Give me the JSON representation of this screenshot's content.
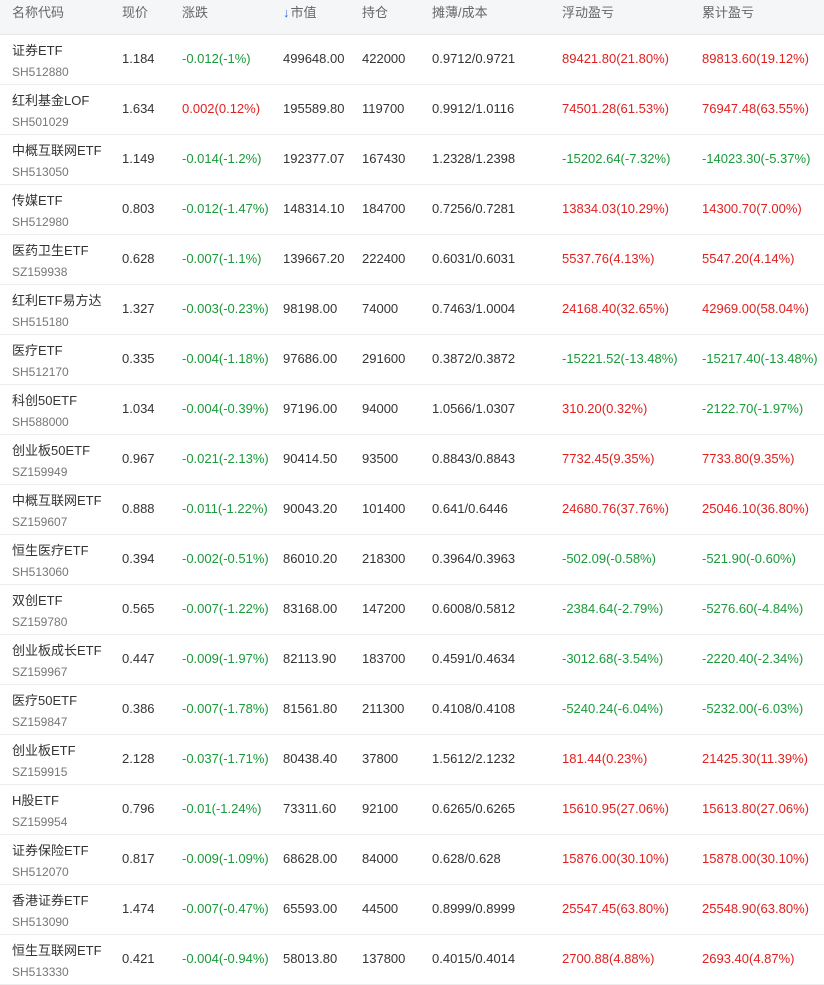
{
  "colors": {
    "up": "#e02020",
    "down": "#1a9a3a",
    "sort_accent": "#2f6fd6"
  },
  "headers": {
    "name_code": "名称代码",
    "price": "现价",
    "change": "涨跌",
    "sort_icon": "↓",
    "market_value": "市值",
    "position": "持仓",
    "cost": "摊薄/成本",
    "floating_pl": "浮动盈亏",
    "cumulative_pl": "累计盈亏"
  },
  "rows": [
    {
      "name": "证券ETF",
      "code": "SH512880",
      "price": "1.184",
      "change": "-0.012(-1%)",
      "change_dir": "down",
      "market_value": "499648.00",
      "position": "422000",
      "cost": "0.9712/0.9721",
      "floating_pl": "89421.80(21.80%)",
      "floating_dir": "up",
      "cumulative_pl": "89813.60(19.12%)",
      "cumulative_dir": "up"
    },
    {
      "name": "红利基金LOF",
      "code": "SH501029",
      "price": "1.634",
      "change": "0.002(0.12%)",
      "change_dir": "up",
      "market_value": "195589.80",
      "position": "119700",
      "cost": "0.9912/1.0116",
      "floating_pl": "74501.28(61.53%)",
      "floating_dir": "up",
      "cumulative_pl": "76947.48(63.55%)",
      "cumulative_dir": "up"
    },
    {
      "name": "中概互联网ETF",
      "code": "SH513050",
      "price": "1.149",
      "change": "-0.014(-1.2%)",
      "change_dir": "down",
      "market_value": "192377.07",
      "position": "167430",
      "cost": "1.2328/1.2398",
      "floating_pl": "-15202.64(-7.32%)",
      "floating_dir": "down",
      "cumulative_pl": "-14023.30(-5.37%)",
      "cumulative_dir": "down"
    },
    {
      "name": "传媒ETF",
      "code": "SH512980",
      "price": "0.803",
      "change": "-0.012(-1.47%)",
      "change_dir": "down",
      "market_value": "148314.10",
      "position": "184700",
      "cost": "0.7256/0.7281",
      "floating_pl": "13834.03(10.29%)",
      "floating_dir": "up",
      "cumulative_pl": "14300.70(7.00%)",
      "cumulative_dir": "up"
    },
    {
      "name": "医药卫生ETF",
      "code": "SZ159938",
      "price": "0.628",
      "change": "-0.007(-1.1%)",
      "change_dir": "down",
      "market_value": "139667.20",
      "position": "222400",
      "cost": "0.6031/0.6031",
      "floating_pl": "5537.76(4.13%)",
      "floating_dir": "up",
      "cumulative_pl": "5547.20(4.14%)",
      "cumulative_dir": "up"
    },
    {
      "name": "红利ETF易方达",
      "code": "SH515180",
      "price": "1.327",
      "change": "-0.003(-0.23%)",
      "change_dir": "down",
      "market_value": "98198.00",
      "position": "74000",
      "cost": "0.7463/1.0004",
      "floating_pl": "24168.40(32.65%)",
      "floating_dir": "up",
      "cumulative_pl": "42969.00(58.04%)",
      "cumulative_dir": "up"
    },
    {
      "name": "医疗ETF",
      "code": "SH512170",
      "price": "0.335",
      "change": "-0.004(-1.18%)",
      "change_dir": "down",
      "market_value": "97686.00",
      "position": "291600",
      "cost": "0.3872/0.3872",
      "floating_pl": "-15221.52(-13.48%)",
      "floating_dir": "down",
      "cumulative_pl": "-15217.40(-13.48%)",
      "cumulative_dir": "down"
    },
    {
      "name": "科创50ETF",
      "code": "SH588000",
      "price": "1.034",
      "change": "-0.004(-0.39%)",
      "change_dir": "down",
      "market_value": "97196.00",
      "position": "94000",
      "cost": "1.0566/1.0307",
      "floating_pl": "310.20(0.32%)",
      "floating_dir": "up",
      "cumulative_pl": "-2122.70(-1.97%)",
      "cumulative_dir": "down"
    },
    {
      "name": "创业板50ETF",
      "code": "SZ159949",
      "price": "0.967",
      "change": "-0.021(-2.13%)",
      "change_dir": "down",
      "market_value": "90414.50",
      "position": "93500",
      "cost": "0.8843/0.8843",
      "floating_pl": "7732.45(9.35%)",
      "floating_dir": "up",
      "cumulative_pl": "7733.80(9.35%)",
      "cumulative_dir": "up"
    },
    {
      "name": "中概互联网ETF",
      "code": "SZ159607",
      "price": "0.888",
      "change": "-0.011(-1.22%)",
      "change_dir": "down",
      "market_value": "90043.20",
      "position": "101400",
      "cost": "0.641/0.6446",
      "floating_pl": "24680.76(37.76%)",
      "floating_dir": "up",
      "cumulative_pl": "25046.10(36.80%)",
      "cumulative_dir": "up"
    },
    {
      "name": "恒生医疗ETF",
      "code": "SH513060",
      "price": "0.394",
      "change": "-0.002(-0.51%)",
      "change_dir": "down",
      "market_value": "86010.20",
      "position": "218300",
      "cost": "0.3964/0.3963",
      "floating_pl": "-502.09(-0.58%)",
      "floating_dir": "down",
      "cumulative_pl": "-521.90(-0.60%)",
      "cumulative_dir": "down"
    },
    {
      "name": "双创ETF",
      "code": "SZ159780",
      "price": "0.565",
      "change": "-0.007(-1.22%)",
      "change_dir": "down",
      "market_value": "83168.00",
      "position": "147200",
      "cost": "0.6008/0.5812",
      "floating_pl": "-2384.64(-2.79%)",
      "floating_dir": "down",
      "cumulative_pl": "-5276.60(-4.84%)",
      "cumulative_dir": "down"
    },
    {
      "name": "创业板成长ETF",
      "code": "SZ159967",
      "price": "0.447",
      "change": "-0.009(-1.97%)",
      "change_dir": "down",
      "market_value": "82113.90",
      "position": "183700",
      "cost": "0.4591/0.4634",
      "floating_pl": "-3012.68(-3.54%)",
      "floating_dir": "down",
      "cumulative_pl": "-2220.40(-2.34%)",
      "cumulative_dir": "down"
    },
    {
      "name": "医疗50ETF",
      "code": "SZ159847",
      "price": "0.386",
      "change": "-0.007(-1.78%)",
      "change_dir": "down",
      "market_value": "81561.80",
      "position": "211300",
      "cost": "0.4108/0.4108",
      "floating_pl": "-5240.24(-6.04%)",
      "floating_dir": "down",
      "cumulative_pl": "-5232.00(-6.03%)",
      "cumulative_dir": "down"
    },
    {
      "name": "创业板ETF",
      "code": "SZ159915",
      "price": "2.128",
      "change": "-0.037(-1.71%)",
      "change_dir": "down",
      "market_value": "80438.40",
      "position": "37800",
      "cost": "1.5612/2.1232",
      "floating_pl": "181.44(0.23%)",
      "floating_dir": "up",
      "cumulative_pl": "21425.30(11.39%)",
      "cumulative_dir": "up"
    },
    {
      "name": "H股ETF",
      "code": "SZ159954",
      "price": "0.796",
      "change": "-0.01(-1.24%)",
      "change_dir": "down",
      "market_value": "73311.60",
      "position": "92100",
      "cost": "0.6265/0.6265",
      "floating_pl": "15610.95(27.06%)",
      "floating_dir": "up",
      "cumulative_pl": "15613.80(27.06%)",
      "cumulative_dir": "up"
    },
    {
      "name": "证券保险ETF",
      "code": "SH512070",
      "price": "0.817",
      "change": "-0.009(-1.09%)",
      "change_dir": "down",
      "market_value": "68628.00",
      "position": "84000",
      "cost": "0.628/0.628",
      "floating_pl": "15876.00(30.10%)",
      "floating_dir": "up",
      "cumulative_pl": "15878.00(30.10%)",
      "cumulative_dir": "up"
    },
    {
      "name": "香港证券ETF",
      "code": "SH513090",
      "price": "1.474",
      "change": "-0.007(-0.47%)",
      "change_dir": "down",
      "market_value": "65593.00",
      "position": "44500",
      "cost": "0.8999/0.8999",
      "floating_pl": "25547.45(63.80%)",
      "floating_dir": "up",
      "cumulative_pl": "25548.90(63.80%)",
      "cumulative_dir": "up"
    },
    {
      "name": "恒生互联网ETF",
      "code": "SH513330",
      "price": "0.421",
      "change": "-0.004(-0.94%)",
      "change_dir": "down",
      "market_value": "58013.80",
      "position": "137800",
      "cost": "0.4015/0.4014",
      "floating_pl": "2700.88(4.88%)",
      "floating_dir": "up",
      "cumulative_pl": "2693.40(4.87%)",
      "cumulative_dir": "up"
    }
  ]
}
